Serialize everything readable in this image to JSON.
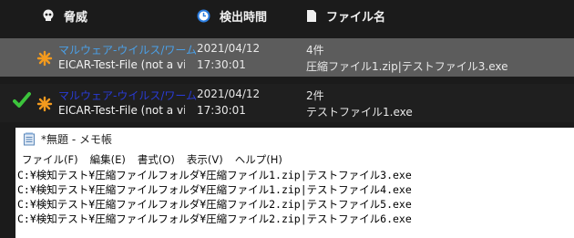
{
  "header": {
    "threat_label": "脅威",
    "detected_label": "検出時間",
    "filename_label": "ファイル名"
  },
  "rows": [
    {
      "threat_name": "マルウェア-ウイルス/ワーム",
      "threat_detail": "EICAR-Test-File (not a virus)",
      "date": "2021/04/12",
      "time": "17:30:01",
      "count": "4件",
      "file": "圧縮ファイル1.zip|テストファイル3.exe",
      "checked": false
    },
    {
      "threat_name": "マルウェア-ウイルス/ワーム",
      "threat_detail": "EICAR-Test-File (not a virus)",
      "date": "2021/04/12",
      "time": "17:30:01",
      "count": "2件",
      "file": "テストファイル1.exe",
      "checked": true
    }
  ],
  "notepad": {
    "title": "*無題 - メモ帳",
    "menu": [
      "ファイル(F)",
      "編集(E)",
      "書式(O)",
      "表示(V)",
      "ヘルプ(H)"
    ],
    "lines": [
      "C:¥検知テスト¥圧縮ファイルフォルダ¥圧縮ファイル1.zip|テストファイル3.exe",
      "C:¥検知テスト¥圧縮ファイルフォルダ¥圧縮ファイル1.zip|テストファイル4.exe",
      "C:¥検知テスト¥圧縮ファイルフォルダ¥圧縮ファイル2.zip|テストファイル5.exe",
      "C:¥検知テスト¥圧縮ファイルフォルダ¥圧縮ファイル2.zip|テストファイル6.exe"
    ]
  },
  "colors": {
    "selected_row": "#5c5c5c",
    "threat_link": "#4aa0e8",
    "warning": "#f39a1e",
    "check": "#3cc43c"
  }
}
